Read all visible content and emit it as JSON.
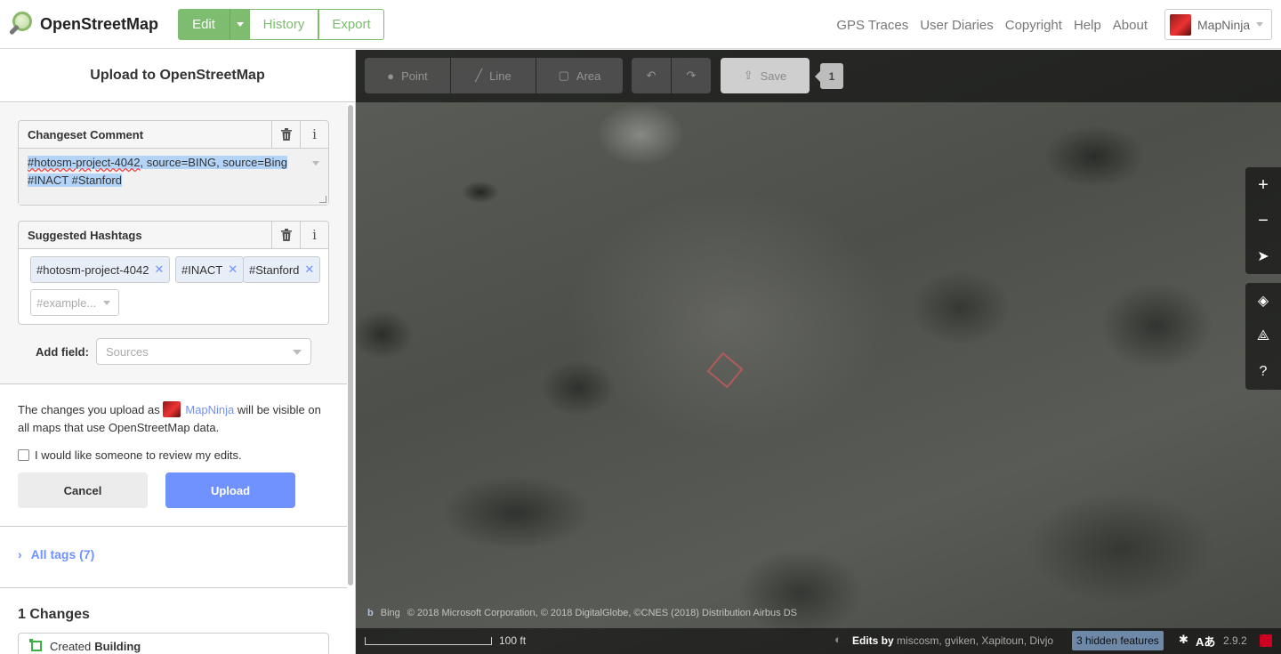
{
  "app": {
    "name": "OpenStreetMap",
    "tabs": {
      "edit": "Edit",
      "history": "History",
      "export": "Export"
    },
    "toplinks": [
      "GPS Traces",
      "User Diaries",
      "Copyright",
      "Help",
      "About"
    ],
    "user": "MapNinja"
  },
  "sidebar": {
    "title": "Upload to OpenStreetMap",
    "changeset": {
      "label": "Changeset Comment",
      "part1": "#hotosm-project-4042",
      "part2": ", source=BING, source=Bing",
      "part3": "#INACT #Stanford"
    },
    "hashtags": {
      "label": "Suggested Hashtags",
      "chips": [
        "#hotosm-project-4042",
        "#INACT",
        "#Stanford"
      ],
      "placeholder": "#example..."
    },
    "add_field": {
      "label": "Add field:",
      "placeholder": "Sources"
    },
    "note": {
      "before": "The changes you upload as",
      "user": "MapNinja",
      "after": "will be visible on all maps that use OpenStreetMap data."
    },
    "review_label": "I would like someone to review my edits.",
    "cancel": "Cancel",
    "upload": "Upload",
    "all_tags": "All tags (7)",
    "changes_title": "1 Changes",
    "change_item": {
      "action": "Created",
      "type": "Building"
    }
  },
  "map": {
    "tools": {
      "point": "Point",
      "line": "Line",
      "area": "Area"
    },
    "save": "Save",
    "save_count": "1",
    "attribution_provider": "Bing",
    "attribution": "© 2018 Microsoft Corporation, © 2018 DigitalGlobe, ©CNES (2018) Distribution Airbus DS",
    "scale_label": "100 ft",
    "edits_by_label": "Edits by",
    "edits_by_users": "miscosm, gviken, Xapitoun, Divjo",
    "hidden_features": "3 hidden features",
    "version": "2.9.2"
  }
}
